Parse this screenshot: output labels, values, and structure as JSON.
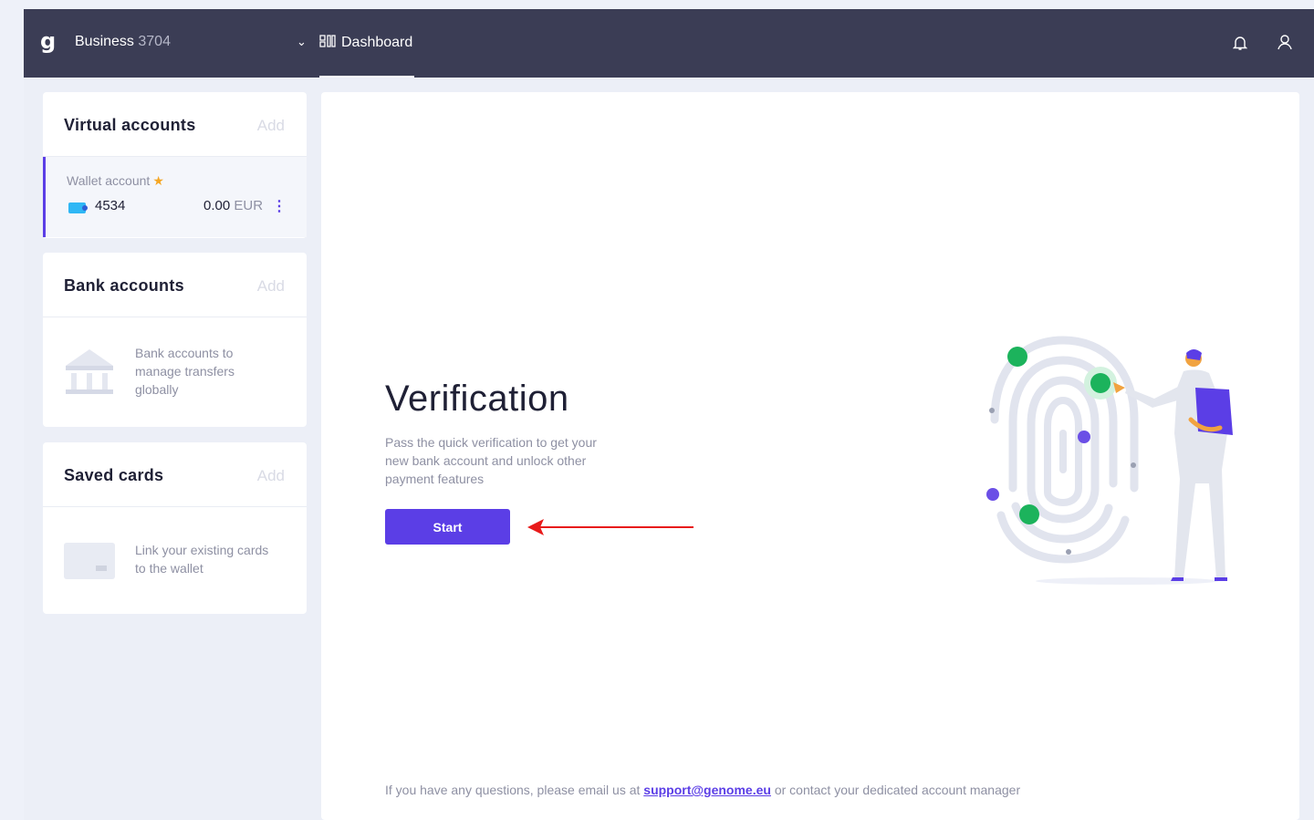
{
  "header": {
    "logo": "g",
    "business_label": "Business",
    "business_number": "3704",
    "tab_dashboard": "Dashboard"
  },
  "virtual_accounts": {
    "title": "Virtual accounts",
    "add_label": "Add",
    "wallet": {
      "label": "Wallet account",
      "account_number": "4534",
      "balance": "0.00",
      "currency": "EUR"
    }
  },
  "bank_accounts": {
    "title": "Bank accounts",
    "add_label": "Add",
    "empty_text": "Bank accounts to manage transfers globally"
  },
  "saved_cards": {
    "title": "Saved cards",
    "add_label": "Add",
    "empty_text": "Link your existing cards to the wallet"
  },
  "verification": {
    "title": "Verification",
    "description": "Pass the quick verification to get your new bank account and unlock other payment features",
    "start_label": "Start"
  },
  "footer": {
    "text_before": "If you have any questions, please email us at ",
    "email": "support@genome.eu",
    "text_after": " or contact your dedicated account manager"
  },
  "colors": {
    "topbar": "#3b3d55",
    "accent": "#5b3ee6",
    "arrow": "#e81a1a",
    "green": "#1cb35c"
  },
  "icons": [
    "genome-logo-icon",
    "chevron-down-icon",
    "dashboard-icon",
    "bell-icon",
    "user-icon",
    "star-icon",
    "flag-icon",
    "kebab-menu-icon",
    "bank-icon",
    "card-icon"
  ]
}
